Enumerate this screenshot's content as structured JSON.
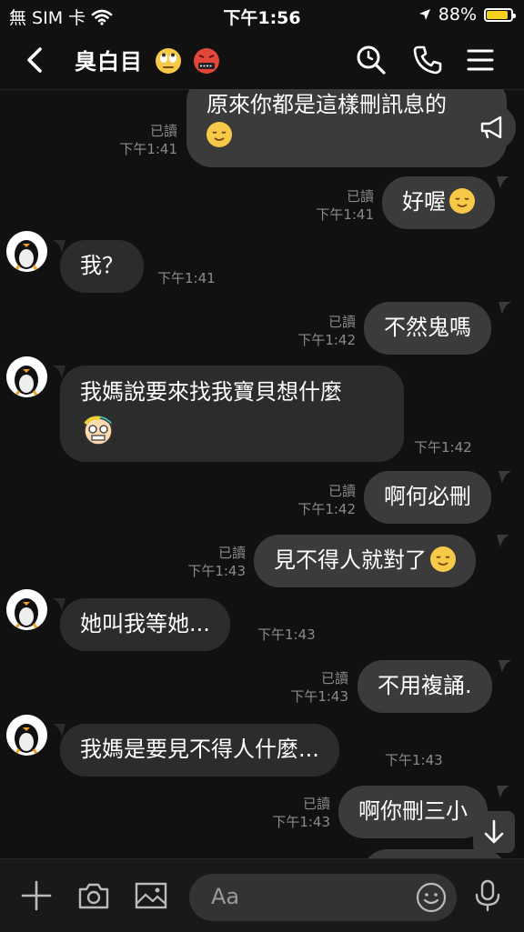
{
  "status_bar": {
    "carrier": "無 SIM 卡",
    "time": "下午1:56",
    "battery_percent": "88%",
    "battery_level": 0.88,
    "battery_color": "#f5cf1e"
  },
  "header": {
    "title": "臭白目"
  },
  "messages": [
    {
      "dir": "out",
      "text": "原來你都是這樣刪訊息的",
      "read": "已讀",
      "time": "下午1:41"
    },
    {
      "dir": "out",
      "text": "好喔",
      "read": "已讀",
      "time": "下午1:41"
    },
    {
      "dir": "in",
      "text": "我？",
      "time": "下午1:41"
    },
    {
      "dir": "out",
      "text": "不然鬼嗎",
      "read": "已讀",
      "time": "下午1:42"
    },
    {
      "dir": "in",
      "text": "我媽說要來找我寶貝想什麼",
      "time": "下午1:42"
    },
    {
      "dir": "out",
      "text": "啊何必刪",
      "read": "已讀",
      "time": "下午1:42"
    },
    {
      "dir": "out",
      "text": "見不得人就對了",
      "read": "已讀",
      "time": "下午1:43"
    },
    {
      "dir": "in",
      "text": "她叫我等她...",
      "time": "下午1:43"
    },
    {
      "dir": "out",
      "text": "不用複誦.",
      "read": "已讀",
      "time": "下午1:43"
    },
    {
      "dir": "in",
      "text": "我媽是要見不得人什麼...",
      "time": "下午1:43"
    },
    {
      "dir": "out",
      "text": "啊你刪三小",
      "read": "已讀",
      "time": "下午1:43"
    }
  ],
  "input": {
    "placeholder": "Aa"
  },
  "icons": {
    "back": "chevron-left-icon",
    "search": "search-icon",
    "call": "phone-icon",
    "menu": "menu-icon",
    "announcement": "megaphone-icon",
    "scroll_down": "arrow-down-icon",
    "add": "plus-icon",
    "camera": "camera-icon",
    "image": "image-icon",
    "emoji": "emoji-icon",
    "voice": "microphone-icon"
  },
  "colors": {
    "background": "#111111",
    "outgoing_bubble": "#3b3b3b",
    "incoming_bubble": "#2c2c2c",
    "meta_text": "#8a8a8a"
  }
}
